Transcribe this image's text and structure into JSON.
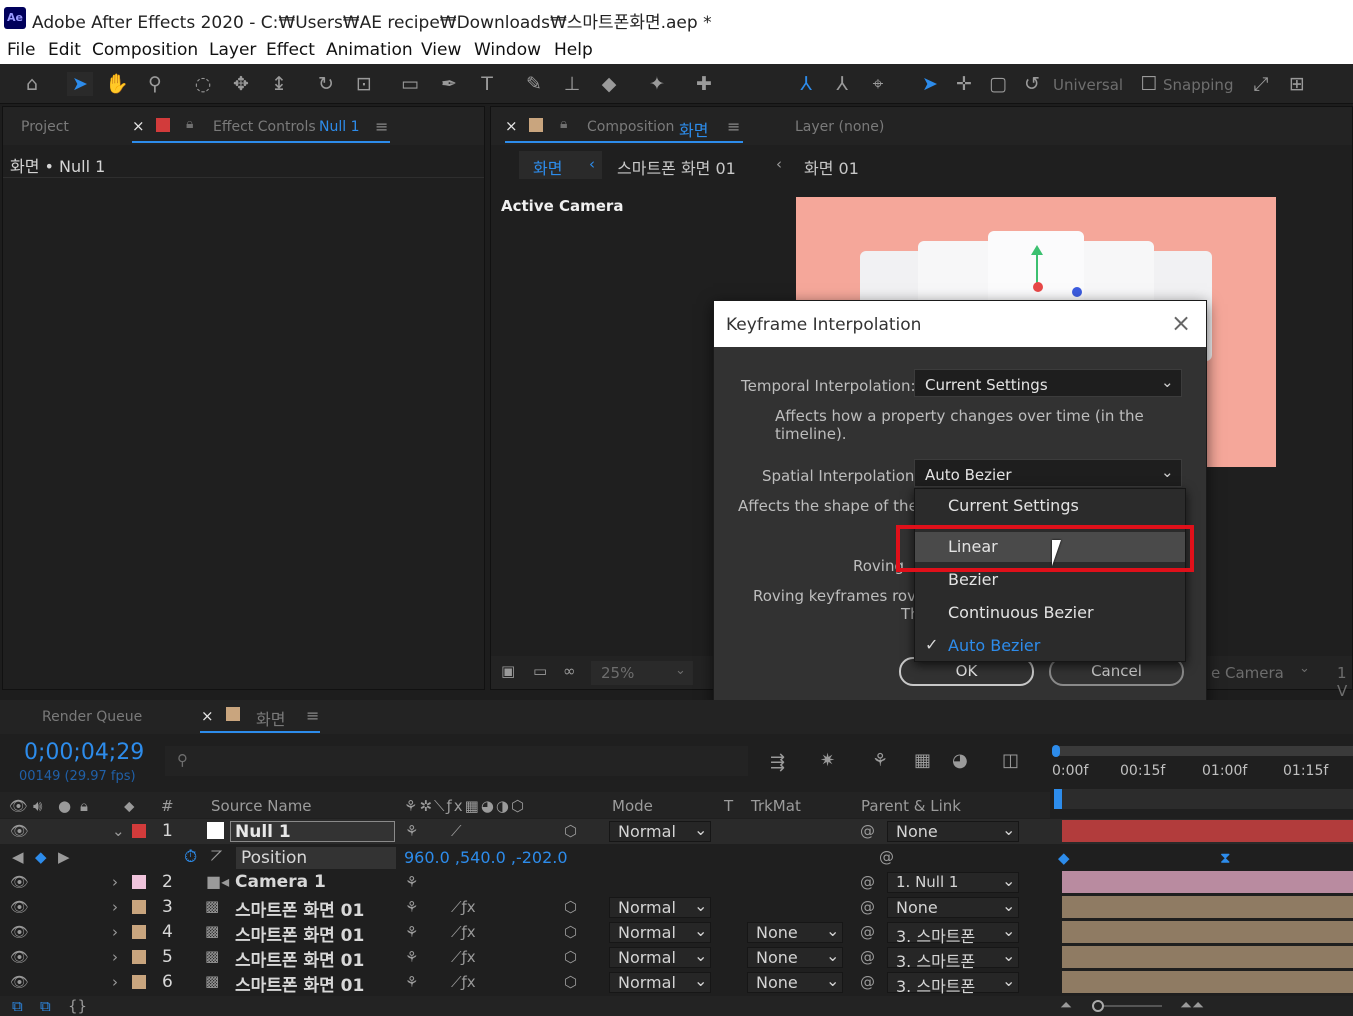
{
  "window": {
    "title": "Adobe After Effects 2020 - C:₩Users₩AE recipe₩Downloads₩스마트폰화면.aep *",
    "logo": "Ae"
  },
  "menu": [
    "File",
    "Edit",
    "Composition",
    "Layer",
    "Effect",
    "Animation",
    "View",
    "Window",
    "Help"
  ],
  "toolbar": {
    "universal": "Universal",
    "snapping": "Snapping"
  },
  "left_panel": {
    "tab_project": "Project",
    "tab_effect_controls": "Effect Controls",
    "effect_target": "Null 1",
    "breadcrumb": "화면 • Null 1"
  },
  "comp_panel": {
    "tab_composition": "Composition",
    "comp_name": "화면",
    "tab_layer": "Layer (none)",
    "crumbs": [
      "화면",
      "스마트폰 화면 01",
      "화면 01"
    ],
    "active_camera": "Active Camera",
    "zoom": "25%",
    "view_select": "e Camera",
    "views_count": "1 V"
  },
  "dialog": {
    "title": "Keyframe Interpolation",
    "temporal_label": "Temporal Interpolation:",
    "temporal_value": "Current Settings",
    "temporal_hint": "Affects how a property changes over time (in the timeline).",
    "spatial_label": "Spatial Interpolation:",
    "spatial_value": "Auto Bezier",
    "spatial_hint": "Affects the shape of the pa",
    "roving_label": "Roving",
    "roving_hint": "Roving keyframes rove i",
    "roving_hint2": "Th",
    "ok": "OK",
    "cancel": "Cancel"
  },
  "dropdown": {
    "options": [
      "Current Settings",
      "Linear",
      "Bezier",
      "Continuous Bezier",
      "Auto Bezier"
    ],
    "hovered": "Linear",
    "selected": "Auto Bezier",
    "highlight_color": "#e0101a",
    "selected_color": "#2d8ceb"
  },
  "timeline": {
    "tab_render_queue": "Render Queue",
    "tab_comp": "화면",
    "timecode": "0;00;04;29",
    "frames": "00149 (29.97 fps)",
    "ruler": [
      "0:00f",
      "00:15f",
      "01:00f",
      "01:15f"
    ],
    "columns": {
      "num": "#",
      "source": "Source Name",
      "mode": "Mode",
      "t": "T",
      "trkmat": "TrkMat",
      "parent": "Parent & Link"
    },
    "position_label": "Position",
    "position_value": "960.0 ,540.0 ,-202.0",
    "layers": [
      {
        "num": "1",
        "name": "Null 1",
        "color": "#d23b3b",
        "mode": "Normal",
        "trkmat": "",
        "parent": "None",
        "bar": "#b23c3c"
      },
      {
        "num": "2",
        "name": "Camera 1",
        "color": "#f0c4dc",
        "mode": "",
        "trkmat": "",
        "parent": "1. Null 1",
        "bar": "#b98ba0"
      },
      {
        "num": "3",
        "name": "스마트폰 화면 01",
        "color": "#c9a57e",
        "mode": "Normal",
        "trkmat": "",
        "parent": "None",
        "bar": "#8f7b63"
      },
      {
        "num": "4",
        "name": "스마트폰 화면 01",
        "color": "#c9a57e",
        "mode": "Normal",
        "trkmat": "None",
        "parent": "3. 스마트폰",
        "bar": "#8f7b63"
      },
      {
        "num": "5",
        "name": "스마트폰 화면 01",
        "color": "#c9a57e",
        "mode": "Normal",
        "trkmat": "None",
        "parent": "3. 스마트폰",
        "bar": "#8f7b63"
      },
      {
        "num": "6",
        "name": "스마트폰 화면 01",
        "color": "#c9a57e",
        "mode": "Normal",
        "trkmat": "None",
        "parent": "3. 스마트폰",
        "bar": "#8f7b63"
      }
    ]
  }
}
